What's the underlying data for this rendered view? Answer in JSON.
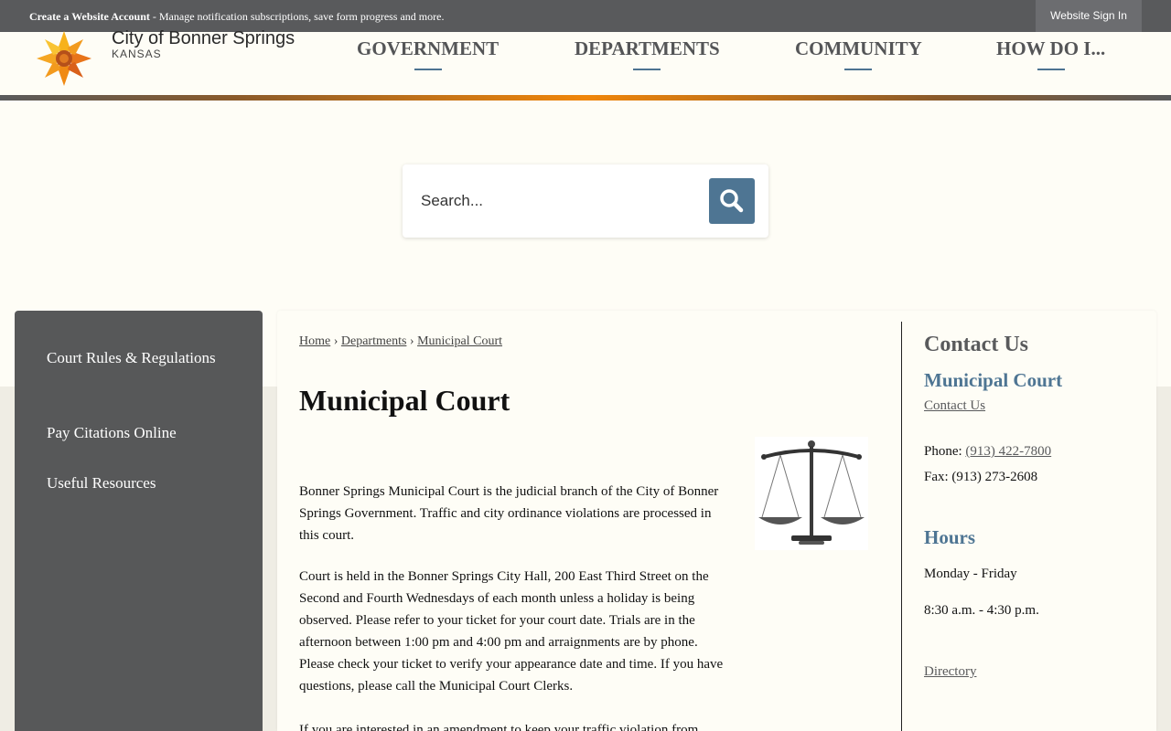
{
  "topbar": {
    "create_account_label": "Create a Website Account",
    "create_account_desc": " - Manage notification subscriptions, save form progress and more.",
    "signin_label": "Website Sign In"
  },
  "header": {
    "logo_title": "City of Bonner Springs",
    "logo_subtitle": "KANSAS",
    "nav": [
      {
        "label": "GOVERNMENT"
      },
      {
        "label": "DEPARTMENTS"
      },
      {
        "label": "COMMUNITY"
      },
      {
        "label": "HOW DO I..."
      }
    ]
  },
  "search": {
    "placeholder": "Search...",
    "icon": "search-icon"
  },
  "sidebar": {
    "items": [
      {
        "label": "Court Rules & Regulations"
      },
      {
        "label": "Pay Citations Online"
      },
      {
        "label": "Useful Resources"
      }
    ]
  },
  "breadcrumb": {
    "items": [
      "Home",
      "Departments",
      "Municipal Court"
    ],
    "separator": "›"
  },
  "main": {
    "title": "Municipal Court",
    "paragraphs": [
      "Bonner Springs Municipal Court is the judicial branch of the City of Bonner Springs Government. Traffic and city ordinance violations are processed in this court.",
      "Court is held in the Bonner Springs City Hall, 200 East Third Street on the Second and Fourth Wednesdays of each month unless a holiday is being observed. Please refer to your ticket for your court date. Trials are in the afternoon between 1:00 pm and 4:00 pm and arraignments are by phone. Please check your ticket to verify your appearance date and time. If you have questions, please call the Municipal Court Clerks.",
      "If you are interested in an amendment to keep your traffic violation from"
    ],
    "image_icon": "scales-of-justice-icon"
  },
  "contact": {
    "heading": "Contact Us",
    "department": "Municipal Court",
    "contact_link": "Contact Us",
    "phone_label": "Phone: ",
    "phone": "(913) 422-7800",
    "fax_label": "Fax: ",
    "fax": "(913) 273-2608",
    "hours_heading": "Hours",
    "hours_days": "Monday - Friday",
    "hours_time": "8:30 a.m. - 4:30 p.m.",
    "directory_link": "Directory"
  },
  "colors": {
    "topbar": "#595a5c",
    "accent_blue": "#4e7593",
    "accent_orange": "#f0860a",
    "sidebar": "#575859",
    "background": "#fefdf6"
  }
}
